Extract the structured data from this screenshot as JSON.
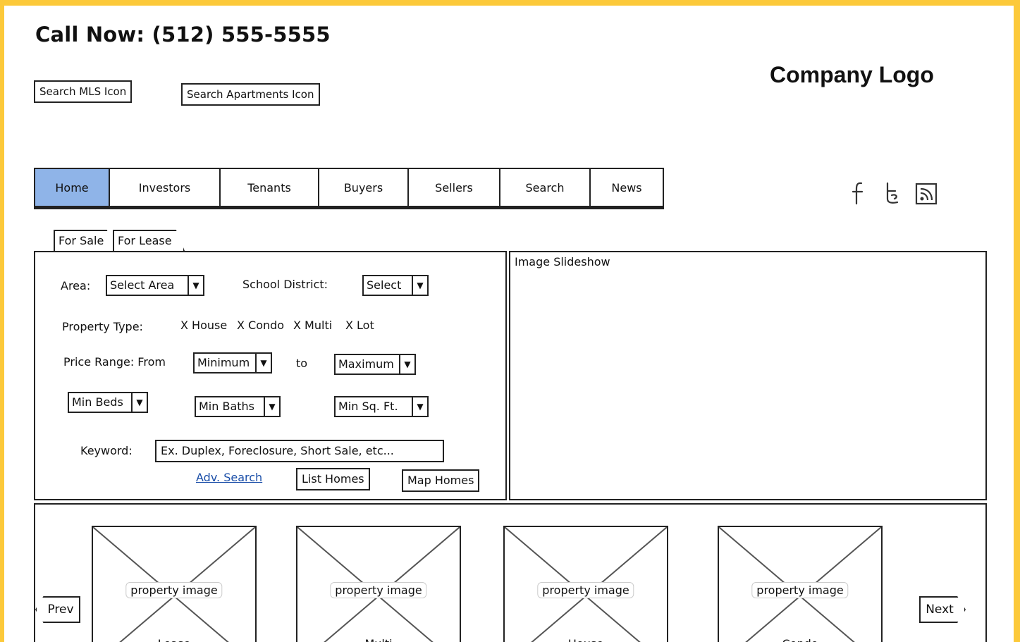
{
  "header": {
    "call_now": "Call Now: (512) 555-5555",
    "logo": "Company Logo",
    "search_mls": "Search MLS Icon",
    "search_apartments": "Search Apartments Icon"
  },
  "nav": {
    "items": [
      "Home",
      "Investors",
      "Tenants",
      "Buyers",
      "Sellers",
      "Search",
      "News"
    ],
    "active": "Home"
  },
  "social": {
    "facebook": "f",
    "twitter": "t",
    "rss": "rss"
  },
  "tabs": [
    "For Sale",
    "For Lease"
  ],
  "search": {
    "area_label": "Area:",
    "area_value": "Select Area",
    "school_label": "School District:",
    "school_value": "Select",
    "property_type_label": "Property Type:",
    "property_types": [
      "X House",
      "X Condo",
      "X Multi",
      "X Lot"
    ],
    "price_label": "Price Range: From",
    "price_min": "Minimum",
    "price_to": "to",
    "price_max": "Maximum",
    "min_beds": "Min Beds",
    "min_baths": "Min Baths",
    "min_sqft": "Min Sq. Ft.",
    "keyword_label": "Keyword:",
    "keyword_placeholder": "Ex. Duplex, Foreclosure, Short Sale, etc...",
    "adv_search": "Adv. Search",
    "list_homes": "List Homes",
    "map_homes": "Map Homes"
  },
  "slideshow": {
    "label": "Image Slideshow"
  },
  "carousel": {
    "prev": "Prev",
    "next": "Next",
    "items": [
      {
        "caption": "property image",
        "type": "Lease"
      },
      {
        "caption": "property image",
        "type": "Multi"
      },
      {
        "caption": "property image",
        "type": "House"
      },
      {
        "caption": "property image",
        "type": "Condo"
      }
    ]
  },
  "colors": {
    "frame": "#fcc93a",
    "active_tab": "#8fb4e8",
    "link": "#1a4ea8"
  }
}
